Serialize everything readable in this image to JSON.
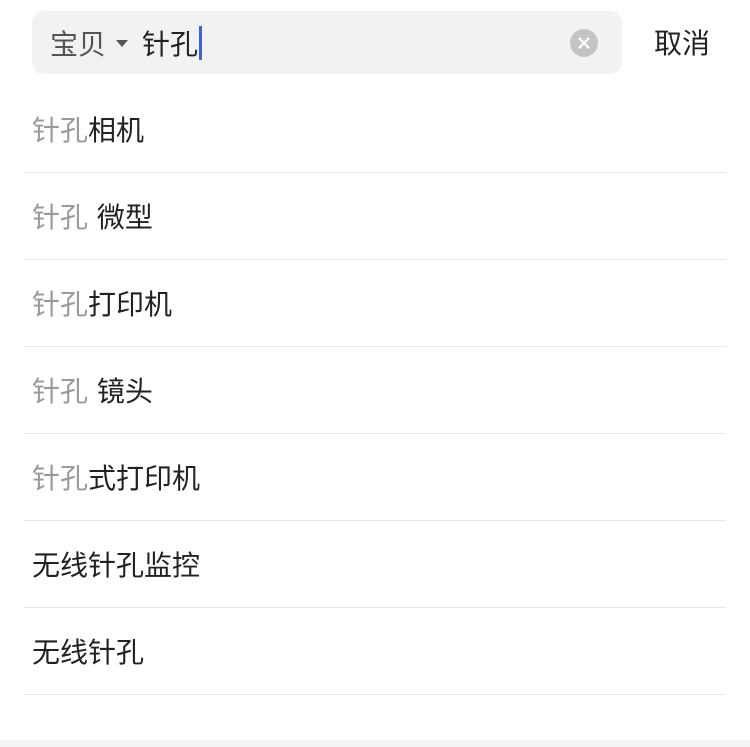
{
  "search": {
    "scope_label": "宝贝",
    "query": "针孔",
    "cancel_label": "取消"
  },
  "suggestions": [
    {
      "highlight": "针孔",
      "rest": "相机"
    },
    {
      "highlight": "针孔",
      "rest": " 微型"
    },
    {
      "highlight": "针孔",
      "rest": "打印机"
    },
    {
      "highlight": "针孔",
      "rest": " 镜头"
    },
    {
      "highlight": "针孔",
      "rest": "式打印机"
    },
    {
      "highlight": "",
      "rest": "无线针孔监控"
    },
    {
      "highlight": "",
      "rest": "无线针孔"
    }
  ],
  "colors": {
    "accent_cursor": "#3a63d6",
    "highlight_text": "#9a9a9a",
    "primary_text": "#222222",
    "search_bg": "#f2f2f2"
  },
  "icons": {
    "scope_dropdown": "caret-down-icon",
    "clear": "clear-circle-x-icon"
  }
}
